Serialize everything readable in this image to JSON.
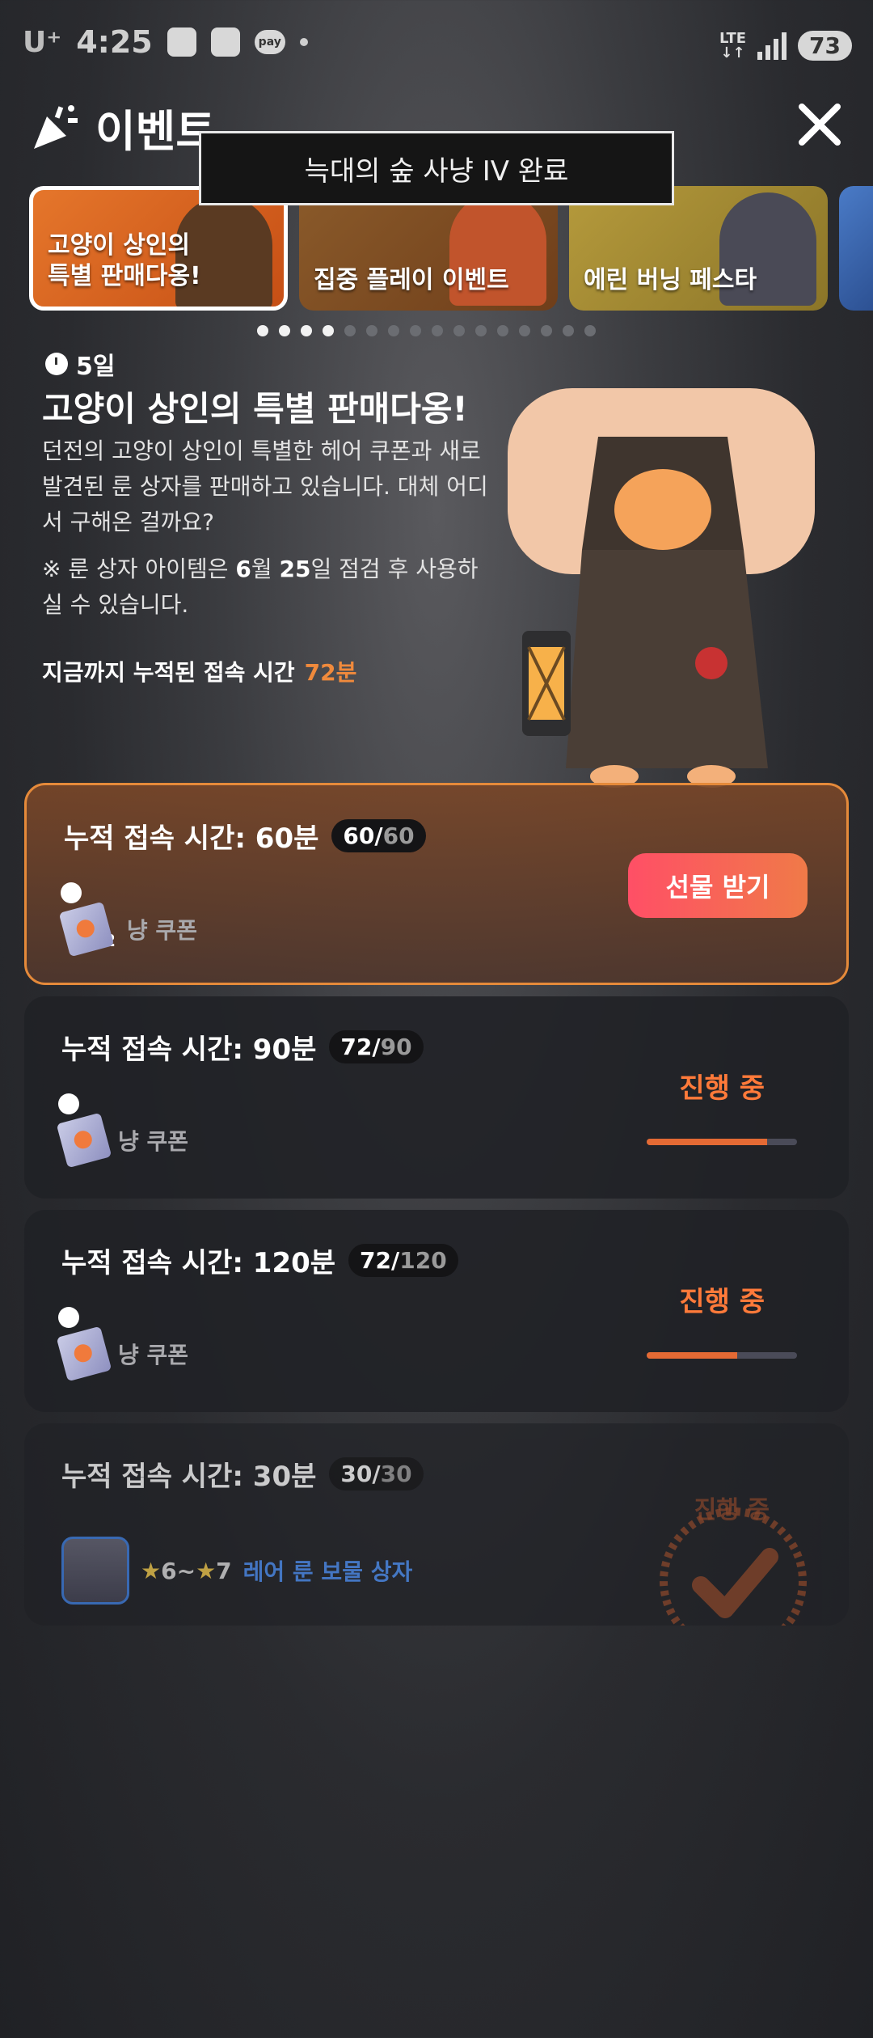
{
  "status_bar": {
    "carrier": "U⁺",
    "time": "4:25",
    "network": "LTE",
    "battery": "73",
    "icons": [
      "screenshot-icon",
      "app-icon",
      "pay-icon",
      "dot-icon",
      "signal-icon"
    ]
  },
  "header": {
    "title": "이벤트",
    "close_icon": "close-icon"
  },
  "toast": "늑대의 숲 사냥 IV 완료",
  "banners": [
    {
      "label": "고양이 상인의\n특별 판매다옹!",
      "selected": true
    },
    {
      "label": "집중 플레이 이벤트",
      "selected": false
    },
    {
      "label": "에린 버닝 페스타",
      "selected": false
    }
  ],
  "pager": {
    "total": 16,
    "active": 3
  },
  "event": {
    "days_left": "5일",
    "title": "고양이 상인의 특별 판매다옹!",
    "description": "던전의 고양이 상인이 특별한 헤어 쿠폰과 새로 발견된 룬 상자를 판매하고 있습니다. 대체 어디서 구해온 걸까요?",
    "notice_prefix": "※ 룬 상자 아이템은 ",
    "notice_month": "6",
    "notice_month_unit": "월 ",
    "notice_day": "25",
    "notice_suffix": "일 점검 후 사용하실 수 있습니다.",
    "accum_label": "지금까지 누적된 접속 시간",
    "accum_value": "72분"
  },
  "rewards": [
    {
      "title": "누적 접속 시간: 60분",
      "current": "60",
      "total": "60",
      "item": "냥 쿠폰",
      "qty": "2",
      "state": "claim",
      "action": "선물 받기",
      "progress": 1.0
    },
    {
      "title": "누적 접속 시간: 90분",
      "current": "72",
      "total": "90",
      "item": "냥 쿠폰",
      "state": "in_progress",
      "action": "진행 중",
      "progress": 0.8
    },
    {
      "title": "누적 접속 시간: 120분",
      "current": "72",
      "total": "120",
      "item": "냥 쿠폰",
      "state": "in_progress",
      "action": "진행 중",
      "progress": 0.6
    },
    {
      "title": "누적 접속 시간: 30분",
      "current": "30",
      "total": "30",
      "item_stars_from": "6",
      "item_stars_sep": "~",
      "item_stars_to": "7",
      "item": "레어 룬 보물 상자",
      "state": "received",
      "stamp_text": "진행 중"
    }
  ],
  "colors": {
    "accent": "#f08a3c",
    "claim_button": "#ff4f66",
    "progress": "#e46a34",
    "rare": "#4b8ef3"
  }
}
